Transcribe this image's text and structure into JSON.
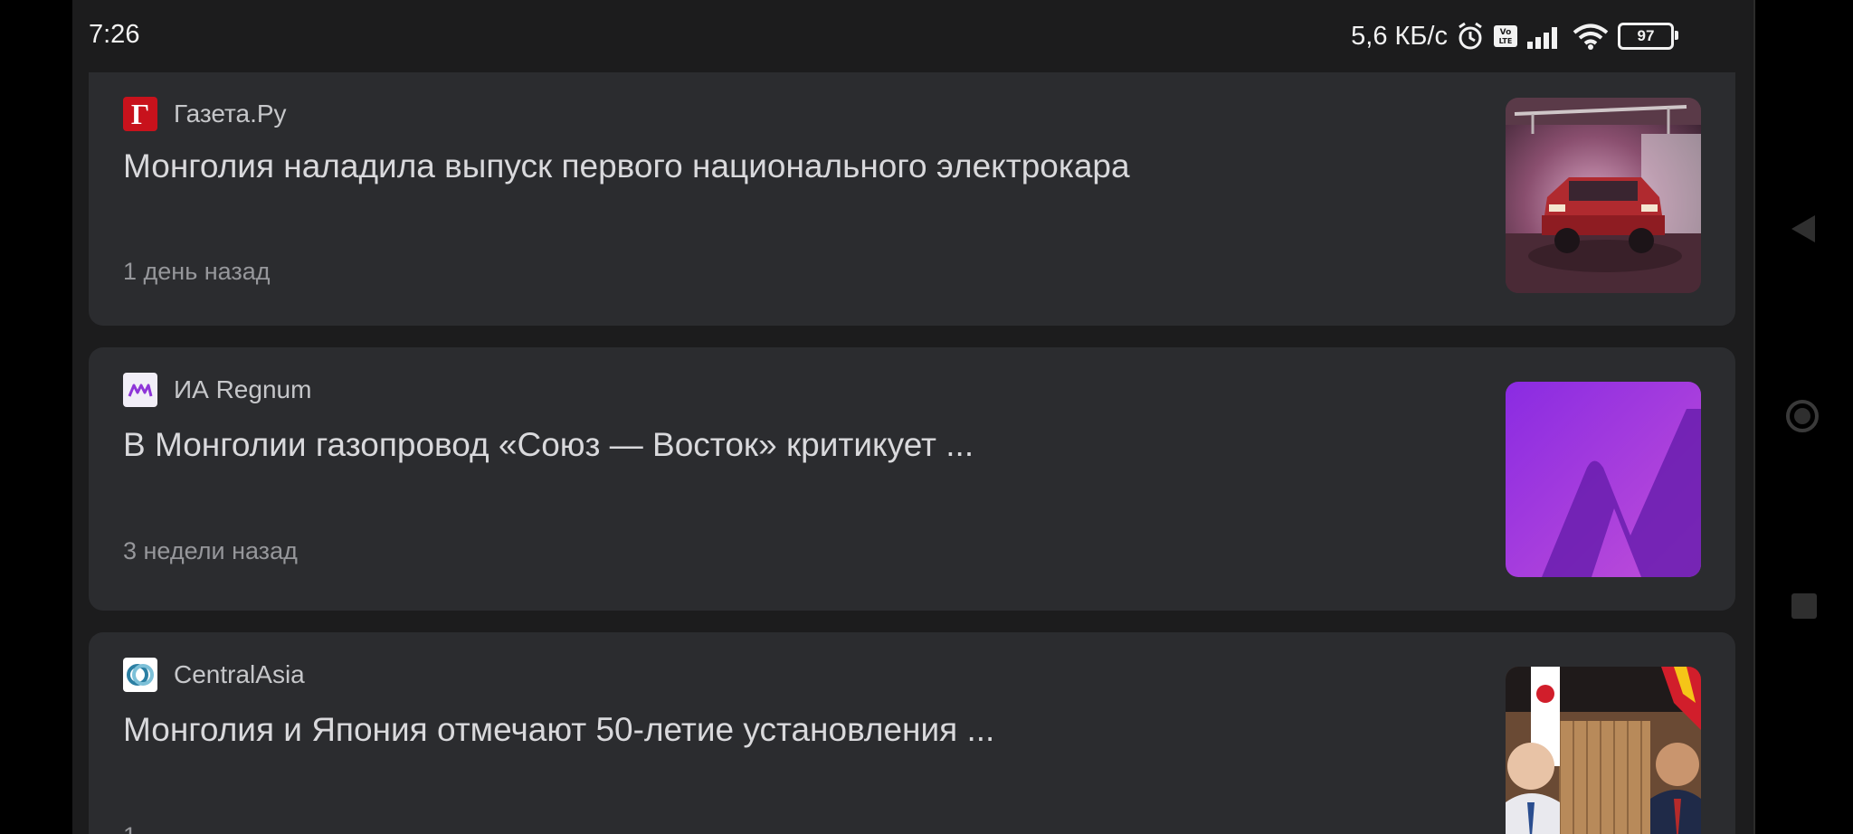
{
  "status": {
    "time": "7:26",
    "net_speed": "5,6 КБ/с",
    "battery": "97",
    "icons": [
      "alarm-icon",
      "volte-icon",
      "signal-icon",
      "wifi-icon",
      "battery-icon"
    ]
  },
  "feed": [
    {
      "source": "Газета.Ру",
      "logo": "Г",
      "title": "Монголия наладила выпуск первого национального электрокара",
      "time": "1 день назад"
    },
    {
      "source": "ИА Regnum",
      "title": "В Монголии газопровод «Союз — Восток» критикует ...",
      "time": "3 недели назад"
    },
    {
      "source": "CentralAsia",
      "title": "Монголия и Япония отмечают 50-летие установления ...",
      "time": "1"
    }
  ],
  "colors": {
    "background": "#1c1c1d",
    "card": "#2b2c2f",
    "regnum_purple": "#8e35d8",
    "gazeta_red": "#c8121c"
  }
}
